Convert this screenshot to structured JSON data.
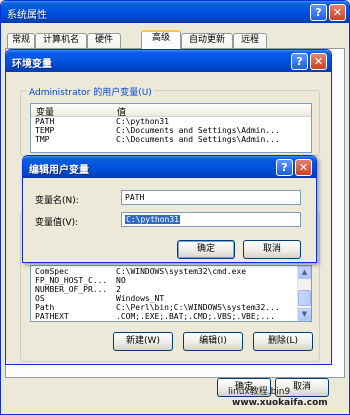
{
  "outer": {
    "title": "系统属性",
    "help_btn": "?",
    "close_btn": "✕",
    "tabs": [
      "常规",
      "计算机名",
      "硬件",
      "高级",
      "自动更新",
      "远程"
    ],
    "ok_label": "确定",
    "cancel_label": "取消"
  },
  "env": {
    "title": "环境变量",
    "help_btn": "?",
    "close_btn": "✕",
    "user_group_label": "Administrator 的用户变量(U)",
    "col_var": "变量",
    "col_val": "值",
    "user_vars": [
      {
        "name": "PATH",
        "value": "C:\\python31"
      },
      {
        "name": "TEMP",
        "value": "C:\\Documents and Settings\\Admin..."
      },
      {
        "name": "TMP",
        "value": "C:\\Documents and Settings\\Admin..."
      }
    ],
    "sys_vars": [
      {
        "name": "ComSpec",
        "value": "C:\\WINDOWS\\system32\\cmd.exe"
      },
      {
        "name": "FP_NO_HOST_C...",
        "value": "NO"
      },
      {
        "name": "NUMBER_OF_PR...",
        "value": "2"
      },
      {
        "name": "OS",
        "value": "Windows_NT"
      },
      {
        "name": "Path",
        "value": "C:\\Perl\\bin;C:\\WINDOWS\\system32..."
      },
      {
        "name": "PATHEXT",
        "value": ".COM;.EXE;.BAT;.CMD;.VBS;.VBE;..."
      }
    ],
    "new_label": "新建(W)",
    "edit_label": "编辑(I)",
    "delete_label": "删除(L)"
  },
  "edit": {
    "title": "编辑用户变量",
    "help_btn": "?",
    "close_btn": "✕",
    "name_label": "变量名(N):",
    "name_value": "PATH",
    "value_label": "变量值(V):",
    "value_value": "C:\\python31",
    "ok_label": "确定",
    "cancel_label": "取消"
  },
  "watermark": {
    "line1": "linux教程.bin9",
    "line2": "www.xuokaifa.com"
  }
}
